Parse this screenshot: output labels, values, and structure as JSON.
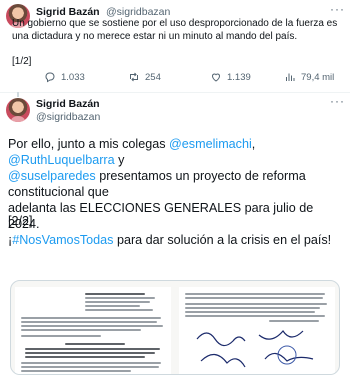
{
  "tweet1": {
    "author_name": "Sigrid Bazán",
    "author_handle": "@sigridbazan",
    "text_line1": "Un gobierno que se sostiene por el uso desproporcionado de la fuerza es",
    "text_line2": "una dictadura y no merece estar ni un minuto al mando del país.",
    "page_counter": "[1/2]",
    "actions": {
      "replies": "1.033",
      "retweets": "254",
      "likes": "1.139",
      "views": "79,4 mil"
    }
  },
  "tweet2": {
    "author_name": "Sigrid Bazán",
    "author_handle": "@sigridbazan",
    "lines": [
      {
        "parts": [
          {
            "text": "Por ello, junto a mis colegas ",
            "link": false
          },
          {
            "text": "@esmelimachi",
            "link": true
          },
          {
            "text": ", ",
            "link": false
          },
          {
            "text": "@RuthLuquelbarra",
            "link": true
          },
          {
            "text": " y",
            "link": false
          }
        ]
      },
      {
        "parts": [
          {
            "text": "@suselparedes",
            "link": true
          },
          {
            "text": " presentamos un proyecto de reforma constitucional que",
            "link": false
          }
        ]
      },
      {
        "parts": [
          {
            "text": "adelanta las ELECCIONES GENERALES para julio de 2024.",
            "link": false
          }
        ]
      },
      {
        "parts": [
          {
            "text": "¡",
            "link": false
          },
          {
            "text": "#NosVamosTodas",
            "link": true
          },
          {
            "text": " para dar solución a la crisis en el país!",
            "link": false
          }
        ]
      }
    ],
    "page_counter": "[2/2]"
  },
  "colors": {
    "link": "#1d9bf0",
    "muted": "#536471",
    "text": "#0f1419",
    "border": "#cfd9de"
  }
}
